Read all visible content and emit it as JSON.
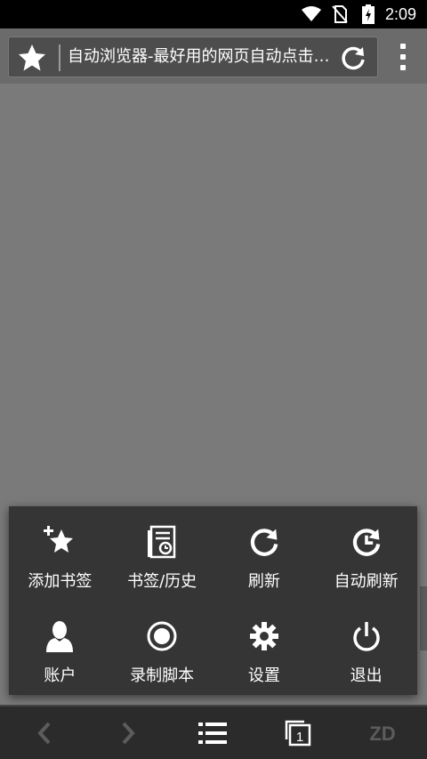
{
  "status_bar": {
    "time": "2:09",
    "icons": [
      "wifi-icon",
      "no-sim-icon",
      "battery-charging-icon"
    ]
  },
  "toolbar": {
    "bookmark_icon": "star-icon",
    "page_title": "自动浏览器-最好用的网页自动点击…",
    "reload_icon": "refresh-icon",
    "menu_icon": "overflow-menu-icon"
  },
  "popup_menu": {
    "items": [
      {
        "label": "添加书签",
        "icon": "add-bookmark-star-icon"
      },
      {
        "label": "书签/历史",
        "icon": "bookmarks-history-icon"
      },
      {
        "label": "刷新",
        "icon": "refresh-icon"
      },
      {
        "label": "自动刷新",
        "icon": "auto-refresh-clock-icon"
      },
      {
        "label": "账户",
        "icon": "account-person-icon"
      },
      {
        "label": "录制脚本",
        "icon": "record-icon"
      },
      {
        "label": "设置",
        "icon": "gear-icon"
      },
      {
        "label": "退出",
        "icon": "power-icon"
      }
    ]
  },
  "bottom_bar": {
    "items": [
      "back-icon",
      "forward-icon",
      "list-menu-icon",
      "tabs-icon",
      "zd-logo-icon"
    ],
    "tab_count": "1",
    "logo_text": "ZD"
  }
}
